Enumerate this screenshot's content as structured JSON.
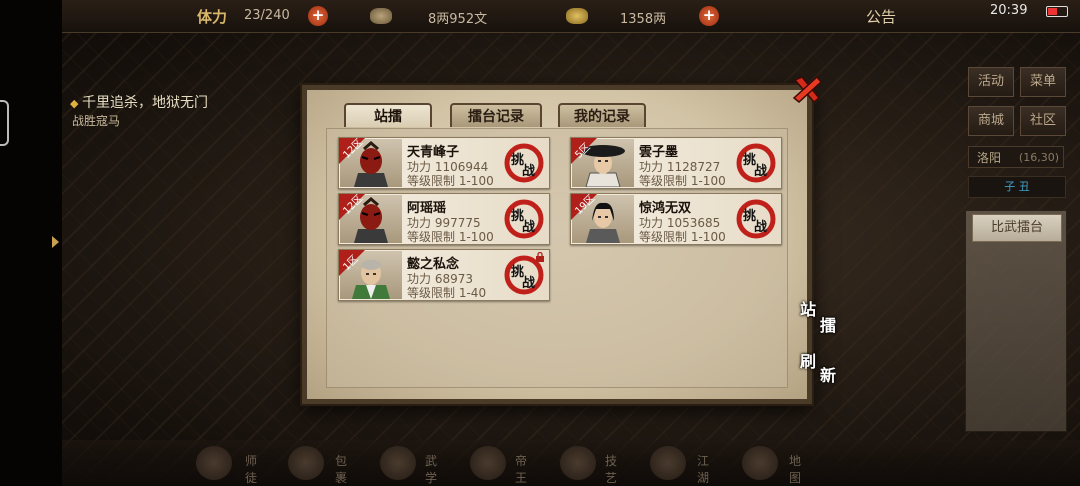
{
  "topbar": {
    "stamina_label": "体力",
    "stamina_value": "23/240",
    "silver_value": "8两952文",
    "gold_value": "1358两",
    "notice": "公告",
    "clock": "20:39"
  },
  "quest": {
    "title": "千里追杀，地狱无门",
    "subtitle": "战胜寇马"
  },
  "side_menu": {
    "items": [
      "活动",
      "菜单",
      "商城",
      "社区"
    ],
    "city": "洛阳",
    "coords": "(16,30)",
    "shichen": "子 丑",
    "arena_button": "比武擂台"
  },
  "dock": {
    "labels": [
      "师徒",
      "包裹",
      "武学",
      "帝王",
      "技艺",
      "江湖",
      "地图"
    ]
  },
  "dialog": {
    "tabs": [
      "站擂",
      "擂台记录",
      "我的记录"
    ],
    "active_tab": "站擂",
    "gongli_label": "功力",
    "level_label": "等级限制",
    "challenge_label": "挑战",
    "players": [
      {
        "zone": "12区",
        "name": "天青峰子",
        "power": "1106944",
        "level": "1-100",
        "mask": "red"
      },
      {
        "zone": "5区",
        "name": "雲子墨",
        "power": "1128727",
        "level": "1-100",
        "mask": "hat"
      },
      {
        "zone": "12区",
        "name": "阿瑶瑶",
        "power": "997775",
        "level": "1-100",
        "mask": "red"
      },
      {
        "zone": "19区",
        "name": "惊鸿无双",
        "power": "1053685",
        "level": "1-100",
        "mask": "hair"
      },
      {
        "zone": "1区",
        "name": "懿之私念",
        "power": "68973",
        "level": "1-40",
        "mask": "monk",
        "locked": true
      }
    ],
    "buttons": {
      "stand": [
        "站",
        "擂"
      ],
      "refresh": [
        "刷",
        "新"
      ]
    }
  },
  "colors": {
    "accent_red": "#b0201a",
    "parchment": "#d2c3a5",
    "frame": "#4a3a28"
  }
}
